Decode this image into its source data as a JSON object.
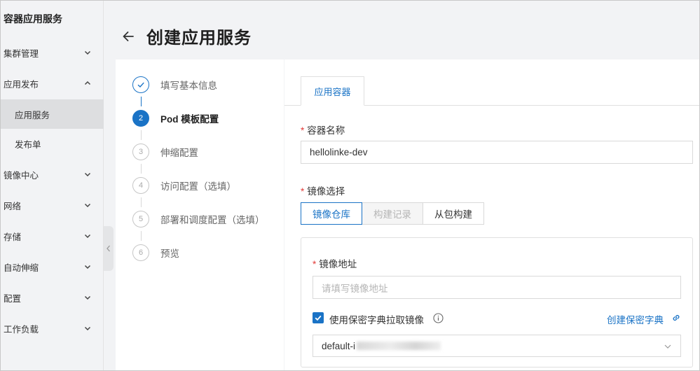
{
  "sidebar": {
    "title": "容器应用服务",
    "items": [
      {
        "label": "集群管理",
        "chevron": "down"
      },
      {
        "label": "应用发布",
        "chevron": "up"
      },
      {
        "label": "应用服务",
        "sub": true,
        "active": true
      },
      {
        "label": "发布单",
        "sub": true
      },
      {
        "label": "镜像中心",
        "chevron": "down"
      },
      {
        "label": "网络",
        "chevron": "down"
      },
      {
        "label": "存储",
        "chevron": "down"
      },
      {
        "label": "自动伸缩",
        "chevron": "down"
      },
      {
        "label": "配置",
        "chevron": "down"
      },
      {
        "label": "工作负载",
        "chevron": "down"
      }
    ]
  },
  "header": {
    "title": "创建应用服务"
  },
  "steps": [
    {
      "number": "1",
      "label": "填写基本信息",
      "state": "done"
    },
    {
      "number": "2",
      "label": "Pod 模板配置",
      "state": "current"
    },
    {
      "number": "3",
      "label": "伸缩配置",
      "state": "pending"
    },
    {
      "number": "4",
      "label": "访问配置（选填）",
      "state": "pending"
    },
    {
      "number": "5",
      "label": "部署和调度配置（选填）",
      "state": "pending"
    },
    {
      "number": "6",
      "label": "预览",
      "state": "pending"
    }
  ],
  "form": {
    "tab_label": "应用容器",
    "required_mark": "*",
    "container_name_label": "容器名称",
    "container_name_value": "hellolinke-dev",
    "image_select_label": "镜像选择",
    "image_source_options": [
      "镜像仓库",
      "构建记录",
      "从包构建"
    ],
    "image_source_selected": "镜像仓库",
    "image_address_label": "镜像地址",
    "image_address_placeholder": "请填写镜像地址",
    "use_secret_label": "使用保密字典拉取镜像",
    "use_secret_checked": true,
    "create_secret_link": "创建保密字典",
    "secret_select_value": "default-i"
  },
  "colors": {
    "accent": "#1a73c6",
    "required": "#e23c39",
    "sidebar_bg": "#f2f3f5",
    "active_item_bg": "#dddee0"
  }
}
